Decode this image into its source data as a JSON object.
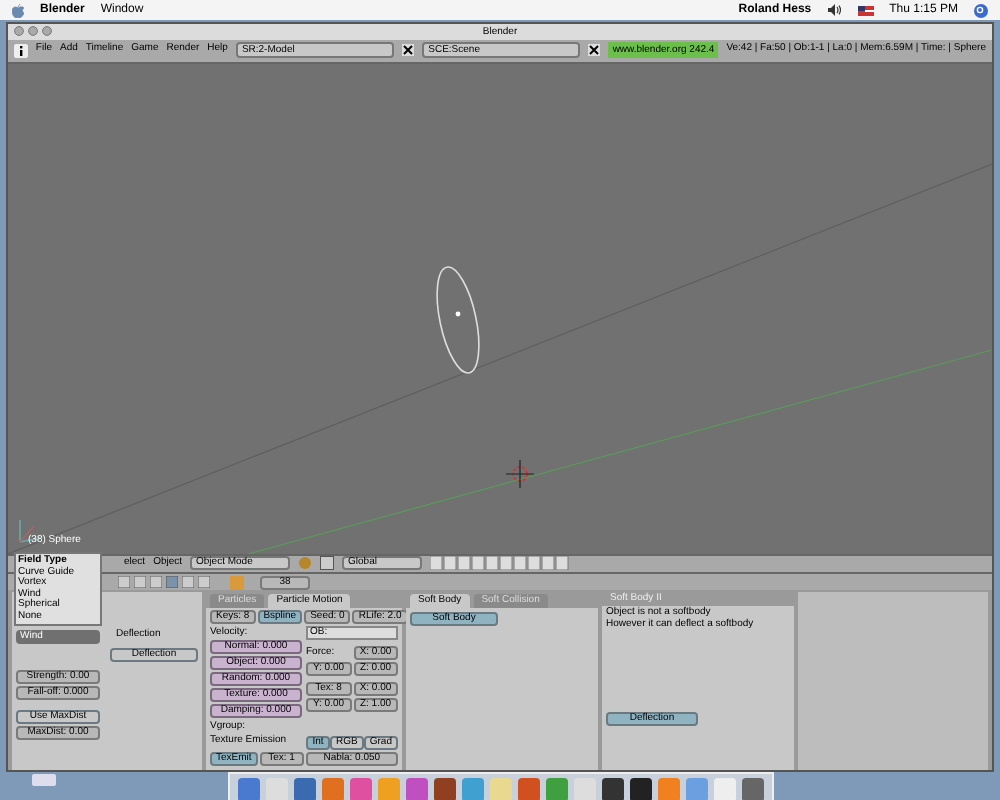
{
  "menubar": {
    "app": "Blender",
    "menus": [
      "Window"
    ],
    "user": "Roland Hess",
    "clock": "Thu 1:15 PM"
  },
  "window": {
    "title": "Blender"
  },
  "header": {
    "menus": [
      "File",
      "Add",
      "Timeline",
      "Game",
      "Render",
      "Help"
    ],
    "screen": "SR:2-Model",
    "scene": "SCE:Scene",
    "version": "www.blender.org 242.4",
    "stats": "Ve:42 | Fa:50 | Ob:1-1 | La:0 | Mem:6.59M | Time: | Sphere"
  },
  "viewport": {
    "object_label": "(38) Sphere"
  },
  "view_header": {
    "menus": [
      "elect",
      "Object"
    ],
    "mode": "Object Mode",
    "orientation": "Global"
  },
  "buttons_header": {
    "frame": "38"
  },
  "field_menu": {
    "title": "Field Type",
    "items": [
      "Curve Guide",
      "Vortex",
      "Wind",
      "Spherical",
      "None"
    ]
  },
  "fields_panel": {
    "field_type": "Wind",
    "deflection_label": "Deflection",
    "deflection_button": "Deflection",
    "fields": [
      "Strength: 0.00",
      "Fall-off: 0.000"
    ],
    "use_maxdist": "Use MaxDist",
    "maxdist": "MaxDist: 0.00"
  },
  "particle_panel": {
    "tabs": [
      {
        "label": "Particles",
        "selected": false
      },
      {
        "label": "Particle Motion",
        "selected": true
      }
    ],
    "top_row": [
      {
        "label": "Keys: 8",
        "kind": "num"
      },
      {
        "label": "Bspline",
        "kind": "toggle",
        "selected": true
      },
      {
        "label": "Seed: 0",
        "kind": "num"
      },
      {
        "label": "RLife: 2.0",
        "kind": "num"
      }
    ],
    "velocity_label": "Velocity:",
    "velocity": [
      "Normal: 0.000",
      "Object: 0.000",
      "Random: 0.000",
      "Texture: 0.000",
      "Damping: 0.000"
    ],
    "vgroup": "Vgroup:",
    "ob": "OB:",
    "force": {
      "label": "Force:",
      "fields": [
        "X: 0.00",
        "Y: 0.00",
        "Z: 0.00"
      ]
    },
    "tex_fields": [
      "Tex: 8",
      "X: 0.00",
      "Y: 0.00",
      "Z: 1.00"
    ],
    "emission_label": "Texture Emission",
    "modes": [
      {
        "label": "Int",
        "selected": true
      },
      {
        "label": "RGB",
        "selected": false
      },
      {
        "label": "Grad",
        "selected": false
      }
    ],
    "texemit": {
      "label": "TexEmit",
      "selected": true
    },
    "tex_index": "Tex: 1",
    "nabla": "Nabla: 0.050"
  },
  "softbody_panel": {
    "tabs": [
      {
        "label": "Soft Body",
        "selected": true
      },
      {
        "label": "Soft Collision",
        "selected": false
      }
    ],
    "button": "Soft Body"
  },
  "softbody2_panel": {
    "title": "Soft Body II",
    "lines": [
      "Object is not a softbody",
      "However it can deflect a softbody"
    ],
    "button": "Deflection"
  }
}
